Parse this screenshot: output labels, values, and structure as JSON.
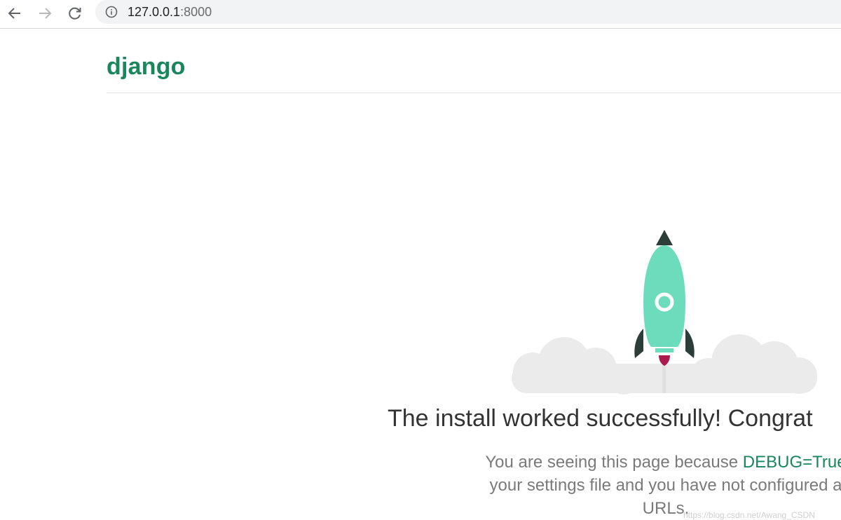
{
  "browser": {
    "url_host": "127.0.0.1",
    "url_port": ":8000"
  },
  "header": {
    "logo_text": "django"
  },
  "main": {
    "headline": "The install worked successfully! Congrat",
    "sub_line1_before": "You are seeing this page because ",
    "sub_line1_code": "DEBUG=True",
    "sub_line2": "your settings file and you have not configured a",
    "sub_line3": "URLs."
  },
  "watermark": "https://blog.csdn.net/Awang_CSDN",
  "colors": {
    "brand_green": "#19865c",
    "rocket_body": "#6ddcbd",
    "rocket_dark": "#2c3e3a",
    "flame": "#aa1a4c",
    "cloud": "#ebebeb"
  }
}
